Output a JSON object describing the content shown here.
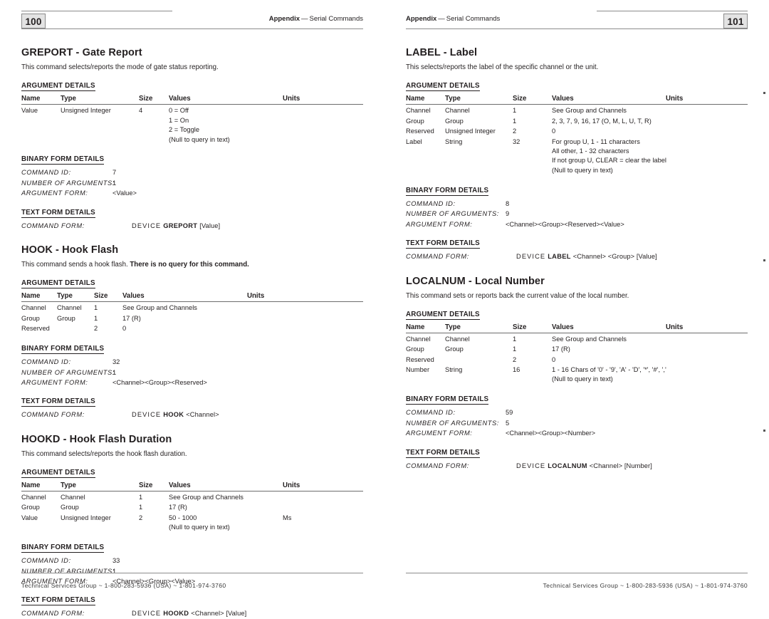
{
  "document": {
    "footer_text": "Technical Services Group ~ 1-800-283-5936 (USA) ~ 1-801-974-3760",
    "running_head_bold": "Appendix",
    "running_head_dash": "—",
    "running_head_rest": "Serial Commands",
    "table_headers": {
      "name": "Name",
      "type": "Type",
      "size": "Size",
      "values": "Values",
      "units": "Units"
    },
    "section_labels": {
      "argument_details": "ARGUMENT DETAILS",
      "binary_form_details": "BINARY FORM DETAILS",
      "text_form_details": "TEXT FORM DETAILS"
    },
    "field_labels": {
      "command_id": "COMMAND ID:",
      "number_of_arguments": "NUMBER OF ARGUMENTS:",
      "argument_form": "ARGUMENT FORM:",
      "command_form": "COMMAND FORM:"
    },
    "device_keyword": "DEVICE"
  },
  "left_page": {
    "page_number": "100",
    "commands": {
      "greport": {
        "title": "GREPORT - Gate Report",
        "description": "This command selects/reports the mode of gate status reporting.",
        "arguments": [
          {
            "name": "Value",
            "type": "Unsigned Integer",
            "size": "4",
            "values": [
              "0 = Off",
              "1 = On",
              "2 = Toggle",
              "(Null to query in text)"
            ],
            "units": ""
          }
        ],
        "binary": {
          "command_id": "7",
          "number_of_arguments": "1",
          "argument_form": "<Value>"
        },
        "text_form": {
          "command_name": "GREPORT",
          "args": "[Value]"
        }
      },
      "hook": {
        "title": "HOOK - Hook Flash",
        "description_plain": "This command sends a hook flash. ",
        "description_bold": "There is no query for this command.",
        "arguments": [
          {
            "name": "Channel",
            "type": "Channel",
            "size": "1",
            "values": [
              "See Group and Channels"
            ],
            "units": ""
          },
          {
            "name": "Group",
            "type": "Group",
            "size": "1",
            "values": [
              "17 (R)"
            ],
            "units": ""
          },
          {
            "name": "Reserved",
            "type": "",
            "size": "2",
            "values": [
              "0"
            ],
            "units": ""
          }
        ],
        "binary": {
          "command_id": "32",
          "number_of_arguments": "1",
          "argument_form": "<Channel><Group><Reserved>"
        },
        "text_form": {
          "command_name": "HOOK",
          "args": "<Channel>"
        }
      },
      "hookd": {
        "title": "HOOKD - Hook Flash Duration",
        "description": "This command selects/reports the hook flash duration.",
        "arguments": [
          {
            "name": "Channel",
            "type": "Channel",
            "size": "1",
            "values": [
              "See Group and Channels"
            ],
            "units": ""
          },
          {
            "name": "Group",
            "type": "Group",
            "size": "1",
            "values": [
              "17 (R)"
            ],
            "units": ""
          },
          {
            "name": "Value",
            "type": "Unsigned Integer",
            "size": "2",
            "values": [
              "50 - 1000",
              "(Null to query in text)"
            ],
            "units": "Ms"
          }
        ],
        "binary": {
          "command_id": "33",
          "number_of_arguments": "1",
          "argument_form": "<Channel><Group><Value>"
        },
        "text_form": {
          "command_name": "HOOKD",
          "args": "<Channel> [Value]"
        }
      }
    }
  },
  "right_page": {
    "page_number": "101",
    "commands": {
      "label": {
        "title": "LABEL - Label",
        "description": "This selects/reports the label of the specific channel or the unit.",
        "arguments": [
          {
            "name": "Channel",
            "type": "Channel",
            "size": "1",
            "values": [
              "See Group and Channels"
            ],
            "units": ""
          },
          {
            "name": "Group",
            "type": "Group",
            "size": "1",
            "values": [
              "2, 3, 7, 9, 16, 17 (O, M, L, U, T, R)"
            ],
            "units": ""
          },
          {
            "name": "Reserved",
            "type": "Unsigned Integer",
            "size": "2",
            "values": [
              "0"
            ],
            "units": ""
          },
          {
            "name": "Label",
            "type": "String",
            "size": "32",
            "values": [
              "For group U, 1 - 11 characters",
              "All other, 1 - 32 characters",
              "If not group U, CLEAR = clear the label",
              "(Null to query in text)"
            ],
            "units": ""
          }
        ],
        "binary": {
          "command_id": "8",
          "number_of_arguments": "9",
          "argument_form": "<Channel><Group><Reserved><Value>"
        },
        "text_form": {
          "command_name": "LABEL",
          "args": "<Channel> <Group> [Value]"
        }
      },
      "localnum": {
        "title": "LOCALNUM - Local Number",
        "description": "This command sets or reports back the current value of the local number.",
        "arguments": [
          {
            "name": "Channel",
            "type": "Channel",
            "size": "1",
            "values": [
              "See Group and Channels"
            ],
            "units": ""
          },
          {
            "name": "Group",
            "type": "Group",
            "size": "1",
            "values": [
              "17 (R)"
            ],
            "units": ""
          },
          {
            "name": "Reserved",
            "type": "",
            "size": "2",
            "values": [
              "0"
            ],
            "units": ""
          },
          {
            "name": "Number",
            "type": "String",
            "size": "16",
            "values": [
              "1 - 16 Chars of '0' - '9', 'A' - 'D', '*', '#', ','",
              "(Null to query in text)"
            ],
            "units": ""
          }
        ],
        "binary": {
          "command_id": "59",
          "number_of_arguments": "5",
          "argument_form": "<Channel><Group><Number>"
        },
        "text_form": {
          "command_name": "LOCALNUM",
          "args": "<Channel> [Number]"
        }
      }
    }
  }
}
